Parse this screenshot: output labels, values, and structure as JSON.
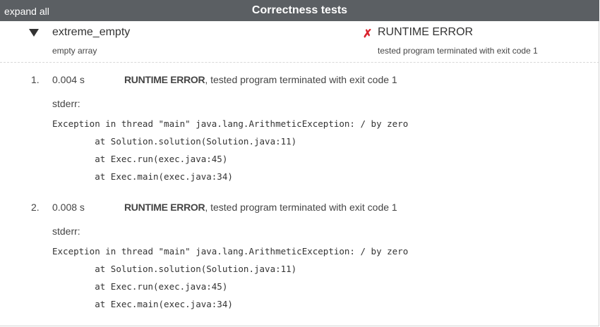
{
  "header": {
    "expand_all": "expand all",
    "title": "Correctness tests"
  },
  "test": {
    "name": "extreme_empty",
    "description": "empty array",
    "status_title": "RUNTIME ERROR",
    "status_detail": "tested program terminated with exit code 1",
    "status_icon": "✗"
  },
  "runs": [
    {
      "index": "1.",
      "time": "0.004 s",
      "result_bold": "RUNTIME ERROR",
      "result_text": ", tested program terminated with exit code 1",
      "stderr_label": "stderr:",
      "stderr": [
        "Exception in thread \"main\" java.lang.ArithmeticException: / by zero",
        "\tat Solution.solution(Solution.java:11)",
        "\tat Exec.run(exec.java:45)",
        "\tat Exec.main(exec.java:34)"
      ]
    },
    {
      "index": "2.",
      "time": "0.008 s",
      "result_bold": "RUNTIME ERROR",
      "result_text": ", tested program terminated with exit code 1",
      "stderr_label": "stderr:",
      "stderr": [
        "Exception in thread \"main\" java.lang.ArithmeticException: / by zero",
        "\tat Solution.solution(Solution.java:11)",
        "\tat Exec.run(exec.java:45)",
        "\tat Exec.main(exec.java:34)"
      ]
    }
  ]
}
